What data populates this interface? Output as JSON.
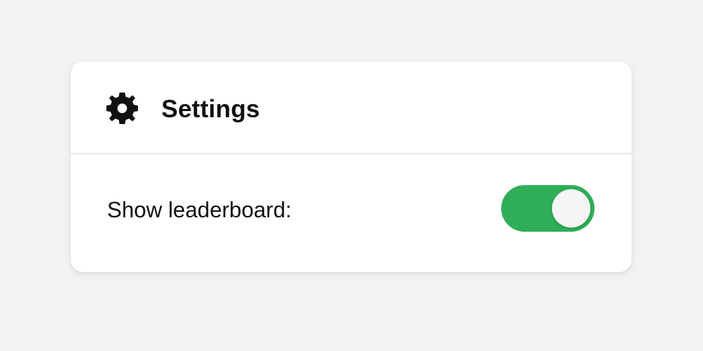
{
  "settings_panel": {
    "header": {
      "icon": "gear-icon",
      "title": "Settings"
    },
    "options": [
      {
        "label": "Show leaderboard:",
        "toggle_state": "on",
        "toggle_value": true
      }
    ]
  },
  "colors": {
    "background": "#f2f2f2",
    "card": "#ffffff",
    "toggle_on": "#2fae57",
    "toggle_knob": "#f5f5f5",
    "text": "#111111"
  }
}
